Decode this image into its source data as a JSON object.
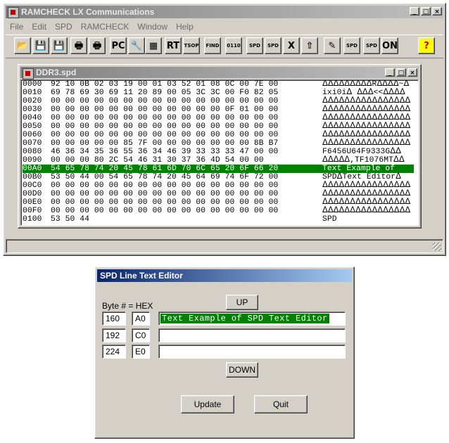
{
  "main_window": {
    "title": "RAMCHECK LX Communications",
    "window_buttons": [
      "_",
      "□",
      "×"
    ],
    "menu": [
      "File",
      "Edit",
      "SPD",
      "RAMCHECK",
      "Window",
      "Help"
    ],
    "toolbar_buttons": [
      {
        "name": "open-icon",
        "label": "📂"
      },
      {
        "name": "save-icon",
        "label": "💾"
      },
      {
        "name": "save-all-icon",
        "label": "💾"
      },
      {
        "name": "print-icon",
        "label": "🖶"
      },
      {
        "name": "printer-setup-icon",
        "label": "🖶"
      },
      {
        "name": "pc-icon",
        "label": "PC"
      },
      {
        "name": "tools-icon",
        "label": "🔧"
      },
      {
        "name": "chip-icon",
        "label": "▦"
      },
      {
        "name": "rt-icon",
        "label": "RT"
      },
      {
        "name": "tsop-icon",
        "label": "TSOP"
      },
      {
        "name": "find-icon",
        "label": "FIND"
      },
      {
        "name": "binary-download-icon",
        "label": "0110"
      },
      {
        "name": "spd-download-icon",
        "label": "SPD"
      },
      {
        "name": "spd-upload-icon",
        "label": "SPD"
      },
      {
        "name": "excel-export-icon",
        "label": "X"
      },
      {
        "name": "upload-icon",
        "label": "⇧"
      },
      {
        "name": "report-icon",
        "label": "✎"
      },
      {
        "name": "spd-wizard-icon",
        "label": "SPD"
      },
      {
        "name": "spd-editor-icon",
        "label": "SPD"
      },
      {
        "name": "power-on-icon",
        "label": "ON"
      },
      {
        "name": "help-icon",
        "label": "?"
      }
    ]
  },
  "doc_window": {
    "title": "DDR3.spd",
    "window_buttons": [
      "_",
      "□",
      "×"
    ],
    "rows": [
      {
        "addr": "0000",
        "bytes": "92 10 0B 02 03 19 00 01 03 52 01 08 0C 00 7E 00",
        "ascii": "ᐃᐃᐃᐃᐃᐃᐃᐃᐃRᐃᐃᐃᐃ~ᐃ"
      },
      {
        "addr": "0010",
        "bytes": "69 78 69 30 69 11 20 89 00 05 3C 3C 00 F0 82 05",
        "ascii": "ixi0iᐃ ᐃᐃᐃ<<ᐃᐃᐃᐃ"
      },
      {
        "addr": "0020",
        "bytes": "00 00 00 00 00 00 00 00 00 00 00 00 00 00 00 00",
        "ascii": "ᐃᐃᐃᐃᐃᐃᐃᐃᐃᐃᐃᐃᐃᐃᐃᐃ"
      },
      {
        "addr": "0030",
        "bytes": "00 00 00 00 00 00 00 00 00 00 00 00 0F 01 00 00",
        "ascii": "ᐃᐃᐃᐃᐃᐃᐃᐃᐃᐃᐃᐃᐃᐃᐃᐃ"
      },
      {
        "addr": "0040",
        "bytes": "00 00 00 00 00 00 00 00 00 00 00 00 00 00 00 00",
        "ascii": "ᐃᐃᐃᐃᐃᐃᐃᐃᐃᐃᐃᐃᐃᐃᐃᐃ"
      },
      {
        "addr": "0050",
        "bytes": "00 00 00 00 00 00 00 00 00 00 00 00 00 00 00 00",
        "ascii": "ᐃᐃᐃᐃᐃᐃᐃᐃᐃᐃᐃᐃᐃᐃᐃᐃ"
      },
      {
        "addr": "0060",
        "bytes": "00 00 00 00 00 00 00 00 00 00 00 00 00 00 00 00",
        "ascii": "ᐃᐃᐃᐃᐃᐃᐃᐃᐃᐃᐃᐃᐃᐃᐃᐃ"
      },
      {
        "addr": "0070",
        "bytes": "00 00 00 00 00 85 7F 00 00 00 00 00 00 00 8B B7",
        "ascii": "ᐃᐃᐃᐃᐃᐃᐃᐃᐃᐃᐃᐃᐃᐃᐃᐃ"
      },
      {
        "addr": "0080",
        "bytes": "46 36 34 35 36 55 36 34 46 39 33 33 33 47 00 00",
        "ascii": "F6456U64F9333Gᐃᐃ"
      },
      {
        "addr": "0090",
        "bytes": "00 00 00 80 2C 54 46 31 30 37 36 4D 54 00 00",
        "ascii": "ᐃᐃᐃᐃᐃ,TF1076MTᐃᐃ"
      },
      {
        "addr": "00A0",
        "bytes": "54 65 78 74 20 45 78 61 6D 70 6C 65 20 6F 66 20",
        "ascii": "Text Example of ",
        "selected": true
      },
      {
        "addr": "00B0",
        "bytes": "53 50 44 00 54 65 78 74 20 45 64 69 74 6F 72 00",
        "ascii": "SPDᐃText Editorᐃ"
      },
      {
        "addr": "00C0",
        "bytes": "00 00 00 00 00 00 00 00 00 00 00 00 00 00 00 00",
        "ascii": "ᐃᐃᐃᐃᐃᐃᐃᐃᐃᐃᐃᐃᐃᐃᐃᐃ"
      },
      {
        "addr": "00D0",
        "bytes": "00 00 00 00 00 00 00 00 00 00 00 00 00 00 00 00",
        "ascii": "ᐃᐃᐃᐃᐃᐃᐃᐃᐃᐃᐃᐃᐃᐃᐃᐃ"
      },
      {
        "addr": "00E0",
        "bytes": "00 00 00 00 00 00 00 00 00 00 00 00 00 00 00 00",
        "ascii": "ᐃᐃᐃᐃᐃᐃᐃᐃᐃᐃᐃᐃᐃᐃᐃᐃ"
      },
      {
        "addr": "00F0",
        "bytes": "00 00 00 00 00 00 00 00 00 00 00 00 00 00 00 00",
        "ascii": "ᐃᐃᐃᐃᐃᐃᐃᐃᐃᐃᐃᐃᐃᐃᐃᐃ"
      },
      {
        "addr": "0100",
        "bytes": "53 50 44",
        "ascii": "SPD"
      }
    ]
  },
  "editor": {
    "title": "SPD Line Text Editor",
    "byte_header": "Byte # = HEX",
    "up_label": "UP",
    "down_label": "DOWN",
    "update_label": "Update",
    "quit_label": "Quit",
    "lines": [
      {
        "byte": "160",
        "hex": "A0",
        "text": "Text Example of SPD Text Editor",
        "selected": true
      },
      {
        "byte": "192",
        "hex": "C0",
        "text": ""
      },
      {
        "byte": "224",
        "hex": "E0",
        "text": ""
      }
    ]
  }
}
